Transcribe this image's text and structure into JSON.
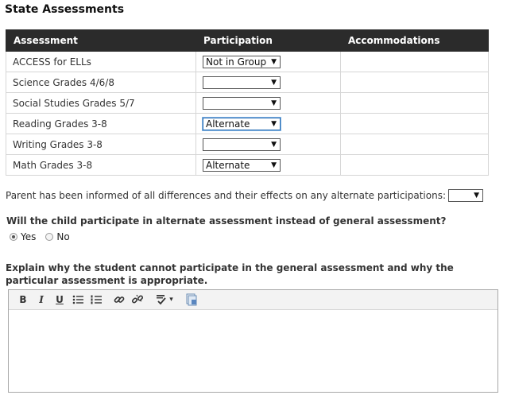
{
  "title": "State Assessments",
  "table": {
    "headers": [
      "Assessment",
      "Participation",
      "Accommodations"
    ],
    "rows": [
      {
        "name": "ACCESS for ELLs",
        "participation": "Not in Group",
        "focused": false
      },
      {
        "name": "Science Grades 4/6/8",
        "participation": "",
        "focused": false
      },
      {
        "name": "Social Studies Grades 5/7",
        "participation": "",
        "focused": false
      },
      {
        "name": "Reading Grades 3-8",
        "participation": "Alternate",
        "focused": true
      },
      {
        "name": "Writing Grades 3-8",
        "participation": "",
        "focused": false
      },
      {
        "name": "Math Grades 3-8",
        "participation": "Alternate",
        "focused": false
      }
    ]
  },
  "parent_informed": {
    "label": "Parent has been informed of all differences and their effects on any alternate participations:",
    "value": ""
  },
  "question": {
    "label": "Will the child participate in alternate assessment instead of general assessment?",
    "options": [
      {
        "label": "Yes",
        "selected": true
      },
      {
        "label": "No",
        "selected": false
      }
    ]
  },
  "explain": {
    "label": "Explain why the student cannot participate in the general assessment and why the particular assessment is appropriate."
  },
  "toolbar": {
    "bold": "B",
    "italic": "I",
    "underline": "U",
    "dropdown_arrow": "▾",
    "select_arrow": "▼"
  }
}
